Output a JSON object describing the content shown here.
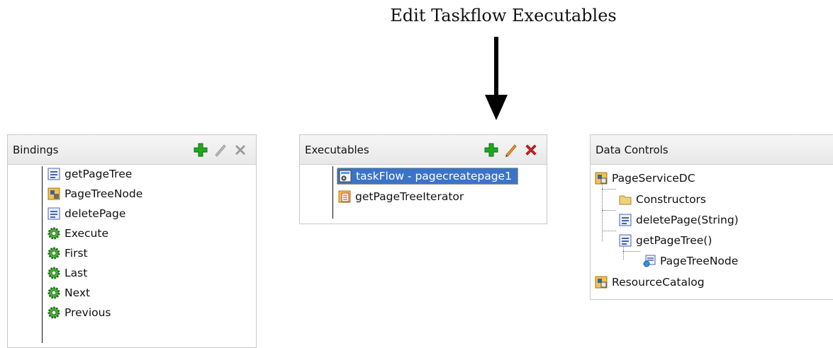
{
  "caption": "Edit Taskflow Executables",
  "bindings": {
    "title": "Bindings",
    "items": [
      {
        "label": "getPageTree",
        "icon": "method-icon"
      },
      {
        "label": "PageTreeNode",
        "icon": "iterator-icon"
      },
      {
        "label": "deletePage",
        "icon": "method-icon"
      },
      {
        "label": "Execute",
        "icon": "action-gear-icon"
      },
      {
        "label": "First",
        "icon": "action-gear-icon"
      },
      {
        "label": "Last",
        "icon": "action-gear-icon"
      },
      {
        "label": "Next",
        "icon": "action-gear-icon"
      },
      {
        "label": "Previous",
        "icon": "action-gear-icon"
      }
    ]
  },
  "executables": {
    "title": "Executables",
    "items": [
      {
        "label": "taskFlow - pagecreatepage1",
        "icon": "taskflow-icon",
        "selected": true
      },
      {
        "label": "getPageTreeIterator",
        "icon": "iterator-list-icon",
        "selected": false
      }
    ]
  },
  "data_controls": {
    "title": "Data Controls",
    "items": [
      {
        "label": "PageServiceDC",
        "icon": "data-control-icon"
      },
      {
        "label": "Constructors",
        "icon": "folder-icon"
      },
      {
        "label": "deletePage(String)",
        "icon": "method-icon"
      },
      {
        "label": "getPageTree()",
        "icon": "method-icon"
      },
      {
        "label": "PageTreeNode",
        "icon": "return-collection-icon"
      },
      {
        "label": "ResourceCatalog",
        "icon": "data-control-icon"
      }
    ]
  },
  "colors": {
    "add_green": "#1fa81f",
    "delete_red": "#d42020",
    "disabled_gray": "#9a9a9a",
    "edit_orange": "#e07a10",
    "selection_blue": "#3b73c8"
  }
}
